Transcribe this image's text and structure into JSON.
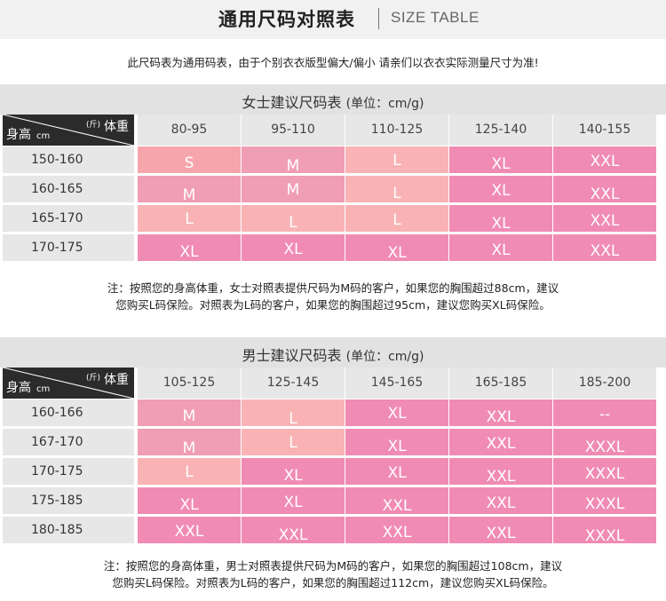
{
  "header": {
    "title": "通用尺码对照表",
    "subtitle": "SIZE TABLE"
  },
  "intro": "此尺码表为通用码表，由于个别衣衣版型偏大/偏小 请亲们以衣衣实际测量尺寸为准!",
  "corner": {
    "weight_unit": "(斤)",
    "weight_label": "体重",
    "height_label": "身高",
    "height_unit": "cm"
  },
  "women": {
    "title": "女士建议尺码表",
    "unit": "(单位：cm/g)",
    "columns": [
      "80-95",
      "95-110",
      "110-125",
      "125-140",
      "140-155"
    ],
    "rows": [
      {
        "height": "150-160",
        "sizes": [
          "S",
          "M",
          "L",
          "XL",
          "XXL"
        ]
      },
      {
        "height": "160-165",
        "sizes": [
          "M",
          "M",
          "L",
          "XL",
          "XXL"
        ]
      },
      {
        "height": "165-170",
        "sizes": [
          "L",
          "L",
          "L",
          "XL",
          "XXL"
        ]
      },
      {
        "height": "170-175",
        "sizes": [
          "XL",
          "XL",
          "XL",
          "XL",
          "XXL"
        ]
      }
    ],
    "note_line1": "注：按照您的身高体重，女士对照表提供尺码为M码的客户，如果您的胸围超过88cm，建议",
    "note_line2": "您购买L码保险。对照表为L码的客户，如果您的胸围超过95cm，建议您购买XL码保险。"
  },
  "men": {
    "title": "男士建议尺码表",
    "unit": "(单位：cm/g)",
    "columns": [
      "105-125",
      "125-145",
      "145-165",
      "165-185",
      "185-200"
    ],
    "rows": [
      {
        "height": "160-166",
        "sizes": [
          "M",
          "L",
          "XL",
          "XXL",
          "--"
        ]
      },
      {
        "height": "167-170",
        "sizes": [
          "M",
          "L",
          "XL",
          "XXL",
          "XXXL"
        ]
      },
      {
        "height": "170-175",
        "sizes": [
          "L",
          "XL",
          "XL",
          "XXL",
          "XXXL"
        ]
      },
      {
        "height": "175-185",
        "sizes": [
          "XL",
          "XL",
          "XXL",
          "XXL",
          "XXXL"
        ]
      },
      {
        "height": "180-185",
        "sizes": [
          "XXL",
          "XXL",
          "XXL",
          "XXL",
          "XXXL"
        ]
      }
    ],
    "note_line1": "注：按照您的身高体重，男士对照表提供尺码为M码的客户，如果您的胸围超过108cm，建议",
    "note_line2": "您购买L码保险。对照表为L码的客户，如果您的胸围超过112cm，建议您购买XL码保险。"
  },
  "colors": {
    "S": "#f6a5ad",
    "M": "#f09db6",
    "L": "#f9b3b5",
    "XL": "#f08bb4",
    "XXL": "#f08bb4",
    "XXXL": "#f08bb4",
    "--": "#f08bb4"
  }
}
